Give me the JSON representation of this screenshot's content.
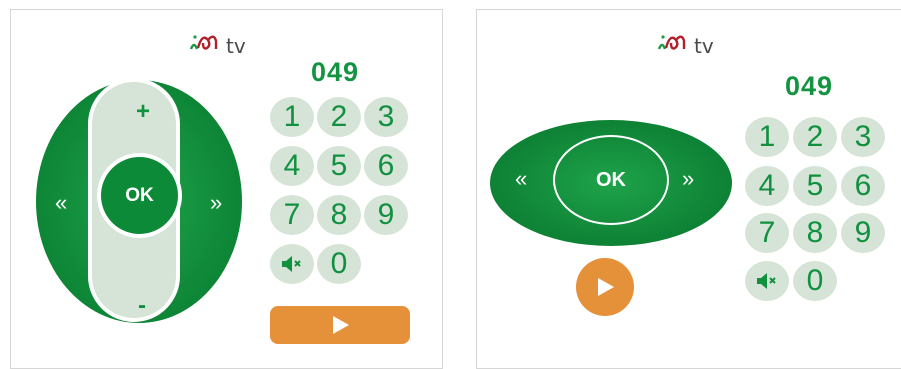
{
  "left_remote": {
    "brand": "tv",
    "channel": "049",
    "ok_label": "OK",
    "plus_label": "+",
    "minus_label": "-",
    "left_arrow": "«",
    "right_arrow": "»",
    "keys": [
      "1",
      "2",
      "3",
      "4",
      "5",
      "6",
      "7",
      "8",
      "9"
    ],
    "zero": "0"
  },
  "right_remote": {
    "brand": "tv",
    "channel": "049",
    "ok_label": "OK",
    "left_arrow": "«",
    "right_arrow": "»",
    "keys": [
      "1",
      "2",
      "3",
      "4",
      "5",
      "6",
      "7",
      "8",
      "9"
    ],
    "zero": "0"
  },
  "colors": {
    "green": "#149443",
    "dark_green": "#0c8a37",
    "key_bg": "#d5e4d6",
    "orange": "#e5913a",
    "logo_red": "#b2202a"
  },
  "icons": [
    "ion-logo-icon",
    "mute-icon",
    "play-icon"
  ]
}
